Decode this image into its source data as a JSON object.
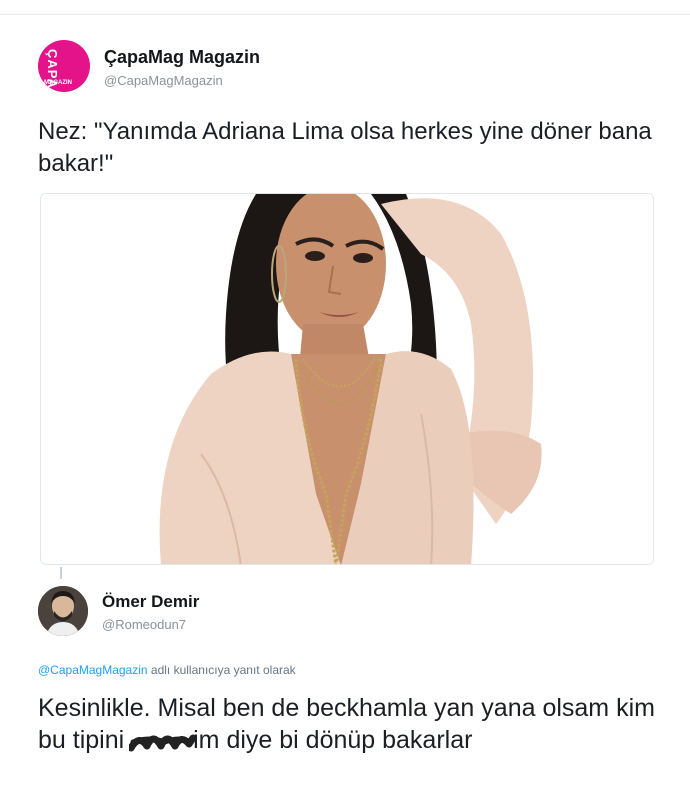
{
  "tweet": {
    "account": {
      "display_name": "ÇapaMag Magazin",
      "handle": "@CapaMagMagazin",
      "logo_text": "ÇAPA",
      "logo_subtext": "MAGAZIN",
      "logo_color": "#e4138a"
    },
    "text": "Nez: \"Yanımda Adriana Lima olsa herkes yine döner bana bakar!\"",
    "media_icon": "photo-of-woman-in-pink-blouse"
  },
  "reply": {
    "author": {
      "display_name": "Ömer Demir",
      "handle": "@Romeodun7"
    },
    "reply_to": {
      "mention": "@CapaMagMagazin",
      "suffix": " adlı kullanıcıya yanıt olarak"
    },
    "text_before": "Kesinlikle. Misal ben de beckhamla yan yana olsam kim bu tipini ",
    "text_after": "im diye bi dönüp bakarlar",
    "redaction_icon": "scribble-redaction"
  },
  "colors": {
    "mention_blue": "#1da1f2",
    "handle_gray": "#8a9299",
    "blouse": "#efd3c2"
  }
}
